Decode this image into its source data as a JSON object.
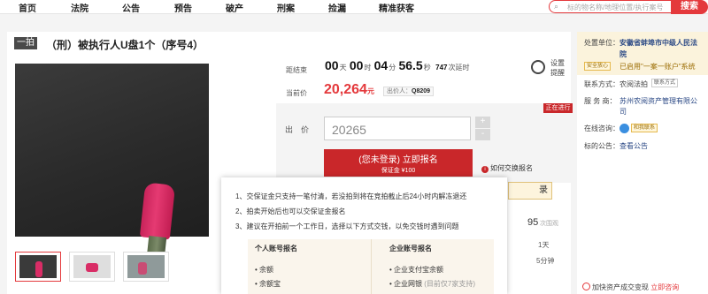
{
  "nav": {
    "items": [
      "首页",
      "法院",
      "公告",
      "预告",
      "破产",
      "刑案",
      "捡漏",
      "精准获客"
    ],
    "search_placeholder": "标的物名称/地理位置/执行案号",
    "search_button": "搜索"
  },
  "lot": {
    "tag": "一拍",
    "title": "（刑）被执行人U盘1个（序号4）"
  },
  "countdown": {
    "label": "距结束",
    "days": "00",
    "days_unit": "天",
    "hours": "00",
    "hours_unit": "时",
    "minutes": "04",
    "minutes_unit": "分",
    "seconds": "56.5",
    "seconds_unit": "秒",
    "delays": "747",
    "delays_unit": "次延时"
  },
  "remind": {
    "line1": "设置",
    "line2": "提醒"
  },
  "price": {
    "label": "当前价",
    "value": "20,264",
    "unit": "元",
    "bidder_label": "出价人：",
    "bidder": "Q8209"
  },
  "bid": {
    "status": "正在进行",
    "label": "出　价",
    "value": "20265",
    "plus": "+",
    "minus": "-",
    "register_l1": "(您未登录) 立即报名",
    "register_l2": "保证金 ¥100",
    "howto": "如何交换报名",
    "login_peek": "录"
  },
  "peeks": {
    "p1": "95",
    "p1b": "次围观",
    "p2": "1天",
    "p3": "5分钟"
  },
  "popup": {
    "lines": [
      "1、交保证金只支持一笔付清，若没拍到将在竞拍截止后24小时内解冻退还",
      "2、拍卖开始后也可以交保证金报名",
      "3、建议在开拍前一个工作日，选择以下方式交钱，以免交钱时遇到问题"
    ],
    "personal_head": "个人账号报名",
    "personal_items": [
      "余额",
      "余额宝"
    ],
    "company_head": "企业账号报名",
    "company_items": [
      "企业支付宝余额"
    ],
    "company_bank": "企业网银",
    "company_bank_note": "(目前仅7家支持)"
  },
  "side": {
    "unit_label": "处置单位：",
    "unit_value_l1": "安徽省蚌埠市中级人民法",
    "unit_value_l2": "院",
    "safety_badge": "安全放心",
    "safety_text": "已启用\"一案一账户\"系统",
    "contact_label": "联系方式：",
    "contact_value": "农阅法拍",
    "contact_btn": "联系方式",
    "service_label": "服 务 商：",
    "service_l1": "苏州农阅资产管理有限公",
    "service_l2": "司",
    "online_label": "在线咨询：",
    "online_btn": "和我联系",
    "notice_label": "标的公告：",
    "notice_link": "查看公告",
    "bottom_text": "加快资产成交变现",
    "bottom_link": "立即咨询"
  }
}
